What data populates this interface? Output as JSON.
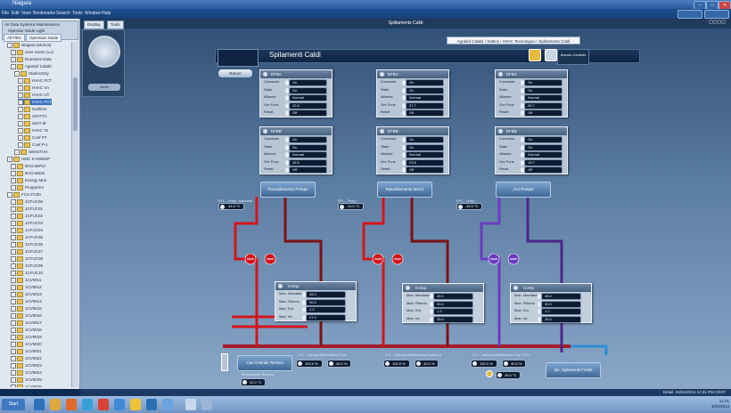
{
  "window": {
    "title": "Niagara"
  },
  "menu": [
    "File",
    "Edit",
    "View",
    "Bookmarks",
    "Search",
    "Tools",
    "Window",
    "Help"
  ],
  "sidebar": {
    "tabs": [
      "All Files",
      "Operation Mode"
    ],
    "header": "Air Data Systems Maintenance",
    "header2": "Operator Mode Light",
    "tree": [
      "Niagara (Monza)",
      "User Home (Lo)",
      "Dummies Data",
      "Agraitof Calabr",
      "StaticsOnly",
      "HVAC FCT",
      "HVAC Vn",
      "HVAC UT",
      "HVAC FCT",
      "Notifiers",
      "UNITTH",
      "UNIT M",
      "HVAC Te",
      "Coef PT",
      "Coef P-1",
      "SelectTren",
      "HMC S-SWEEP",
      "BACnetPtcl",
      "BACnetDis",
      "Energy Mon",
      "Programm",
      "FCU-FC00",
      "1CFUC00",
      "1CFUC01",
      "1CFUC02",
      "1CFUC03",
      "1CFUC04",
      "1CFUC05",
      "1CFUC06",
      "1CFUC07",
      "1CFUC08",
      "1CFUC09",
      "1CFUC10",
      "1CVMI11",
      "1CVMI12",
      "1CVMI13",
      "1CVMI14",
      "1CVMI15",
      "1CVMI16",
      "1CVMI17",
      "1CVMI18",
      "1CVMI19",
      "1CVMI20",
      "1CVMI21",
      "1CVMI22",
      "1CVMI23",
      "1CVMI24",
      "1CVMI25",
      "1CVMI26"
    ]
  },
  "tabs": [
    "Display",
    "Tools"
  ],
  "document_title": "Splitaments Caldi",
  "breadcrumb": "Agraitof Calabr / Statics / HVAC Tecnologico / Splitaments Caldi",
  "page_title": "Spilamenti Caldi",
  "alarm_controls": "Alarms Controls",
  "return_btn": "Return",
  "zoom_label": "None",
  "unit_labels": {
    "mode": "Comando",
    "state": "Stato",
    "fault": "Allarme",
    "flow": "Ore Funz",
    "reset": "Reset"
  },
  "upper_units": [
    {
      "name": "EFBA",
      "mode": "On",
      "state": "On",
      "fault": "Normal",
      "flow": "22.6",
      "reset": "Off"
    },
    {
      "name": "EFBA",
      "mode": "On",
      "state": "On",
      "fault": "Normal",
      "flow": "27.7",
      "reset": "Off"
    },
    {
      "name": "EFBA",
      "mode": "On",
      "state": "On",
      "fault": "Normal",
      "flow": "28.7",
      "reset": "Off"
    }
  ],
  "lower_units": [
    {
      "name": "EFBB",
      "mode": "On",
      "state": "On",
      "fault": "Normal",
      "flow": "26.5",
      "reset": "Off"
    },
    {
      "name": "EFBB",
      "mode": "On",
      "state": "On",
      "fault": "Normal",
      "flow": "23.8",
      "reset": "Off"
    },
    {
      "name": "EFBB",
      "mode": "On",
      "state": "On",
      "fault": "Normal",
      "flow": "19.7",
      "reset": "Off"
    }
  ],
  "circuit_buttons": [
    "Riscaldamento Pompe",
    "Riscaldamento Mezzi",
    "Acs Pompe"
  ],
  "temps": [
    {
      "label": "EFL - Temp. Mandata",
      "value": "44.6 °C"
    },
    {
      "label": "EFL - Temp.",
      "value": "24.0 °C"
    },
    {
      "label": "EFL - Temp.",
      "value": "43.5 °C"
    }
  ],
  "comp_labels": {
    "m1": "Man. Mandata",
    "m2": "Man. Ritorno",
    "m3": "Man. Est.",
    "m4": "Man. Int."
  },
  "comps": [
    {
      "name": "Comp.",
      "m1": "45.0",
      "m2": "30.0",
      "m3": "1.2",
      "m4": "27.0"
    },
    {
      "name": "Comp.",
      "m1": "45.0",
      "m2": "30.0",
      "m3": "1.3",
      "m4": "28.0"
    },
    {
      "name": "Comp.",
      "m1": "45.0",
      "m2": "30.0",
      "m3": "1.2",
      "m4": "26.0"
    }
  ],
  "bottom": {
    "left_btn": "Cas Centrale Termica",
    "left_lbl": "Temperature Esterna",
    "left_val": "22.0 °C",
    "v1_lbl": "V.S. - Valvola Miscelatrice Pom.",
    "v1_a": "100.0 %",
    "v1_b": "40.0 %",
    "v2_lbl": "V.S. - Valvola Miscelatrice Radiatori",
    "v2_a": "100.0 %",
    "v2_b": "40.0 %",
    "v3_lbl": "V.S. - Valvola Miscelatrice Pav. ACS",
    "v3_a": "100.0 %",
    "v3_b": "40.0 %",
    "v4_val": "45.0 °C",
    "right_btn": "Sis. Splitamenti Freddi"
  },
  "status_text": "Detail: 04/04/2013 12:31 PM CEST",
  "clock": {
    "time": "12:31",
    "date": "4/04/2013"
  },
  "taskbar": {
    "start": "Start"
  },
  "colors": {
    "hot": "#d2161c",
    "hot_dark": "#7a1414",
    "cold": "#6a3cc0",
    "cold_dark": "#4a2788",
    "return": "#a71f2a",
    "accent": "#e4b93d"
  }
}
